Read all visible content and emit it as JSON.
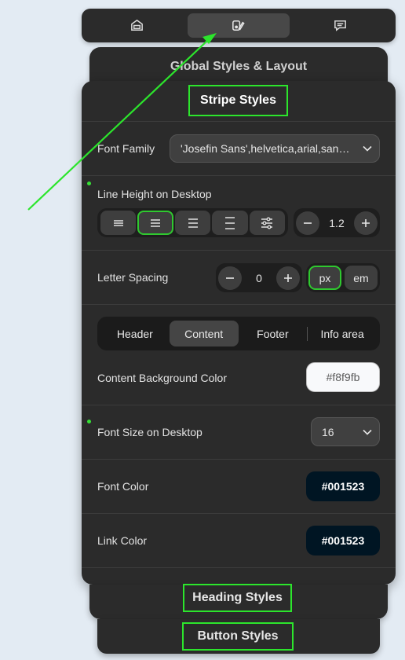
{
  "top_tabs": [
    {
      "icon": "template-icon",
      "active": false
    },
    {
      "icon": "style-brush-icon",
      "active": true
    },
    {
      "icon": "comment-icon",
      "active": false
    }
  ],
  "global_panel": {
    "title": "Global Styles & Layout"
  },
  "stripe_panel": {
    "title": "Stripe Styles",
    "font_family": {
      "label": "Font Family",
      "value": "'Josefin Sans',helvetica,arial,sans-serif"
    },
    "line_height": {
      "label": "Line Height on Desktop",
      "value": "1.2",
      "selected_option": 1,
      "options": [
        "align-left-icon",
        "align-center-icon",
        "align-justify-icon",
        "align-right-icon",
        "sliders-icon"
      ]
    },
    "letter_spacing": {
      "label": "Letter Spacing",
      "value": "0",
      "units": [
        "px",
        "em"
      ],
      "selected_unit": "px"
    },
    "section_tabs": [
      "Header",
      "Content",
      "Footer",
      "Info area"
    ],
    "active_section_tab": "Content",
    "content_bg": {
      "label": "Content Background Color",
      "value": "#f8f9fb"
    },
    "font_size": {
      "label": "Font Size on Desktop",
      "value": "16"
    },
    "font_color": {
      "label": "Font Color",
      "value": "#001523"
    },
    "link_color": {
      "label": "Link Color",
      "value": "#001523"
    }
  },
  "heading_panel": {
    "title": "Heading Styles"
  },
  "button_panel": {
    "title": "Button Styles"
  },
  "colors": {
    "accent_green": "#2ce52c",
    "panel_bg": "#2b2b2b",
    "dark_swatch": "#001523"
  }
}
